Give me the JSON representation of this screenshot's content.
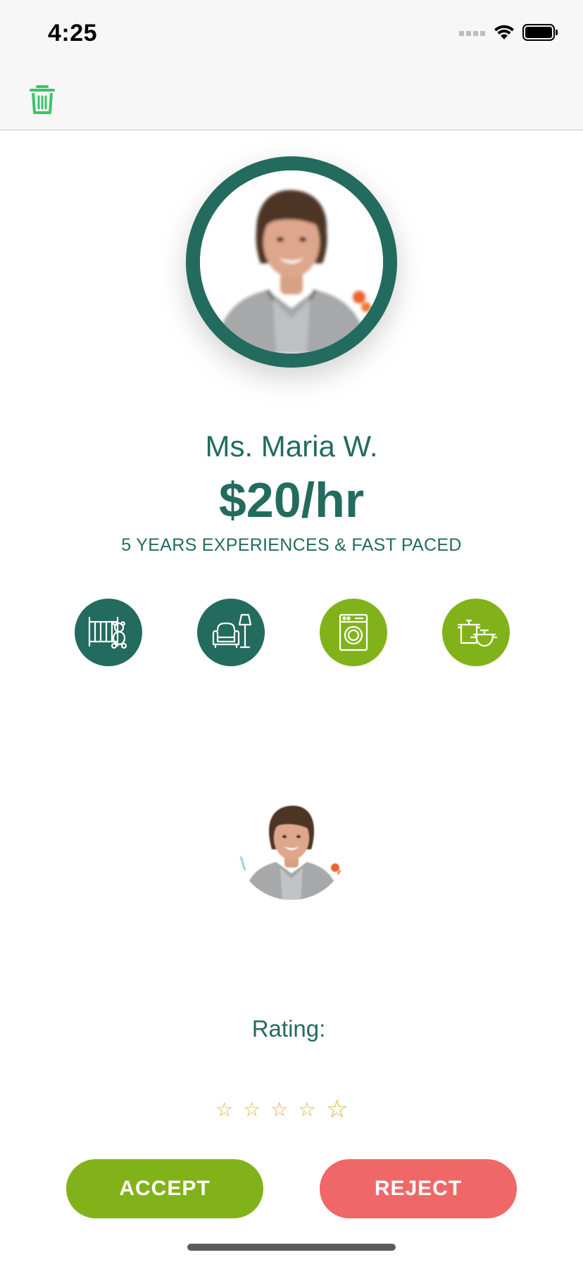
{
  "status_bar": {
    "time": "4:25"
  },
  "nav": {
    "delete_icon": "trash-icon"
  },
  "profile": {
    "name": "Ms. Maria W.",
    "rate": "$20/hr",
    "tagline": "5 YEARS EXPERIENCES & FAST PACED"
  },
  "services": [
    {
      "icon": "crib-teddy-icon",
      "color": "#236b5e"
    },
    {
      "icon": "armchair-lamp-icon",
      "color": "#236b5e"
    },
    {
      "icon": "washing-machine-icon",
      "color": "#82b21a"
    },
    {
      "icon": "cooking-pots-icon",
      "color": "#82b21a"
    }
  ],
  "rating": {
    "label": "Rating:",
    "value": 0,
    "max": 5,
    "star_glyph": "☆"
  },
  "actions": {
    "accept_label": "ACCEPT",
    "reject_label": "REJECT"
  },
  "colors": {
    "brand_green": "#236b5e",
    "accent_green": "#82b21a",
    "reject_red": "#ef6767",
    "star": "#e8b341",
    "trash_icon": "#3cc467"
  }
}
